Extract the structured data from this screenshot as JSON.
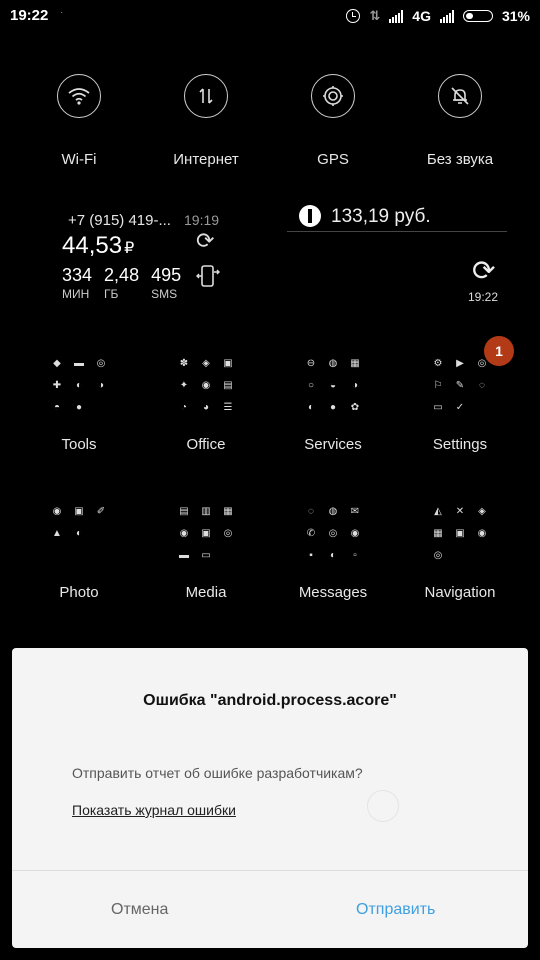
{
  "status_bar": {
    "time": "19:22",
    "network": "4G",
    "battery_percent": "31%",
    "battery_level": 0.31,
    "icons": [
      "alarm-icon",
      "data-transfer-icon",
      "signal-icon",
      "signal-icon",
      "battery-icon"
    ]
  },
  "toggles": [
    {
      "label": "Wi-Fi",
      "icon": "wifi-icon"
    },
    {
      "label": "Интернет",
      "icon": "data-arrows-icon"
    },
    {
      "label": "GPS",
      "icon": "gps-icon"
    },
    {
      "label": "Без звука",
      "icon": "bell-off-icon"
    }
  ],
  "balance_widget": {
    "phone": "+7 (915) 419-...",
    "time": "19:19",
    "amount": "44,53",
    "currency": "₽",
    "stats": [
      {
        "value": "334",
        "unit": "МИН"
      },
      {
        "value": "2,48",
        "unit": "ГБ"
      },
      {
        "value": "495",
        "unit": "SMS"
      }
    ]
  },
  "money_widget": {
    "amount": "133,19 руб.",
    "refresh_time": "19:22"
  },
  "folders": [
    {
      "label": "Tools",
      "badge": ""
    },
    {
      "label": "Office",
      "badge": ""
    },
    {
      "label": "Services",
      "badge": ""
    },
    {
      "label": "Settings",
      "badge": "1"
    },
    {
      "label": "Photo",
      "badge": ""
    },
    {
      "label": "Media",
      "badge": ""
    },
    {
      "label": "Messages",
      "badge": ""
    },
    {
      "label": "Navigation",
      "badge": ""
    }
  ],
  "dialog": {
    "title": "Ошибка \"android.process.acore\"",
    "message": "Отправить отчет об ошибке разработчикам?",
    "log_link": "Показать журнал ошибки",
    "cancel_label": "Отмена",
    "send_label": "Отправить"
  },
  "colors": {
    "accent": "#3f9fe0",
    "badge": "#b33a16",
    "dialog_bg": "#f4f4f4"
  }
}
